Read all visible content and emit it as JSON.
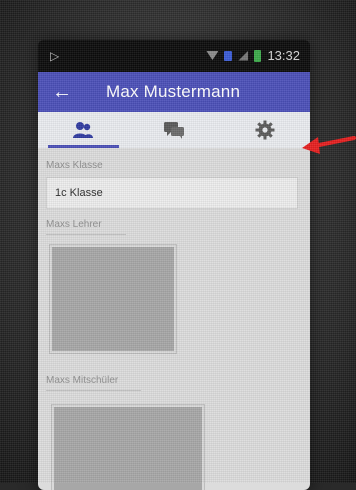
{
  "statusbar": {
    "time": "13:32",
    "left_icon": "play-triangle-icon"
  },
  "appbar": {
    "back_icon": "arrow-back-icon",
    "title": "Max Mustermann"
  },
  "tabs": [
    {
      "icon": "people-icon",
      "active": true
    },
    {
      "icon": "chat-bubbles-icon",
      "active": false
    },
    {
      "icon": "gear-icon",
      "active": false
    }
  ],
  "content": {
    "class_label": "Maxs Klasse",
    "class_value": "1c Klasse",
    "teacher_label": "Maxs Lehrer",
    "classmates_label": "Maxs Mitschüler"
  },
  "annotation": {
    "arrow_color": "#e61f1f",
    "arrow_target": "gear-icon"
  },
  "colors": {
    "appbar": "#4b4fb8",
    "tabs_bg": "#e9ebef",
    "tab_icon": "#2f3aa0",
    "tab_icon_inactive": "#5a5a5a"
  }
}
